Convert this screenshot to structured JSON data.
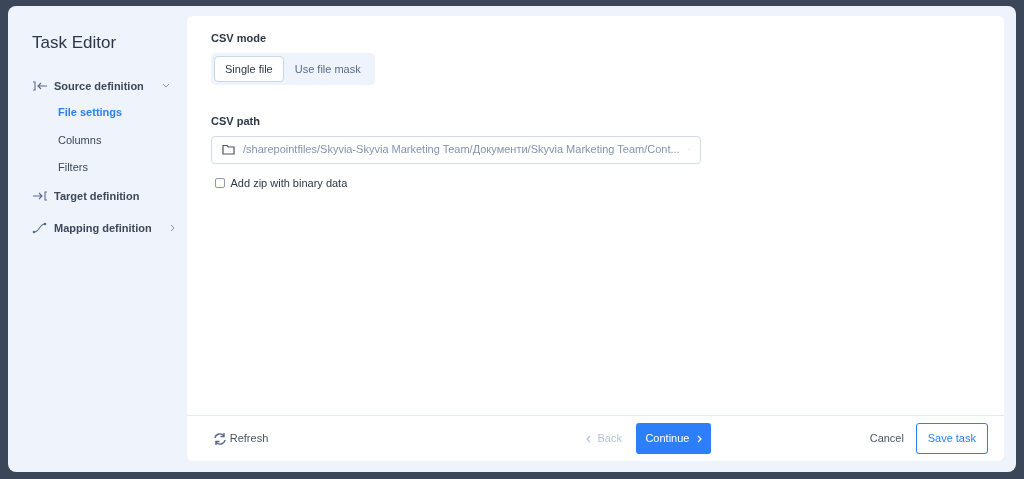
{
  "sidebar": {
    "title": "Task Editor",
    "items": [
      {
        "label": "Source definition",
        "kind": "source",
        "expanded": true,
        "children": [
          {
            "label": "File settings",
            "selected": true
          },
          {
            "label": "Columns",
            "selected": false
          },
          {
            "label": "Filters",
            "selected": false
          }
        ]
      },
      {
        "label": "Target definition",
        "kind": "target"
      },
      {
        "label": "Mapping definition",
        "kind": "mapping",
        "expanded": false
      }
    ]
  },
  "csv_mode": {
    "label": "CSV mode",
    "options": [
      {
        "label": "Single file",
        "selected": true
      },
      {
        "label": "Use file mask",
        "selected": false
      }
    ]
  },
  "csv_path": {
    "label": "CSV path",
    "value": "/sharepointfiles/Skyvia-Skyvia Marketing Team/Документи/Skyvia Marketing Team/Cont..."
  },
  "zip_option": {
    "label": "Add zip with binary data",
    "checked": false
  },
  "footer": {
    "refresh": "Refresh",
    "back": {
      "label": "Back",
      "disabled": true
    },
    "continue": "Continue",
    "cancel": "Cancel",
    "save": "Save task"
  }
}
